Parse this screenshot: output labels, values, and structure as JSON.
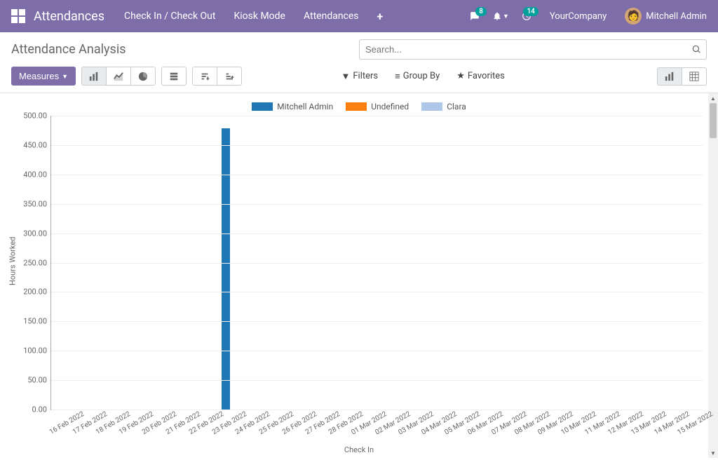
{
  "navbar": {
    "brand": "Attendances",
    "links": [
      "Check In / Check Out",
      "Kiosk Mode",
      "Attendances"
    ],
    "messages_badge": "8",
    "activities_badge": "14",
    "company": "YourCompany",
    "username": "Mitchell Admin"
  },
  "page": {
    "title": "Attendance Analysis",
    "search_placeholder": "Search..."
  },
  "toolbar": {
    "measures": "Measures",
    "filters": "Filters",
    "groupby": "Group By",
    "favorites": "Favorites"
  },
  "chart_data": {
    "type": "bar",
    "title": "",
    "ylabel": "Hours Worked",
    "xlabel": "Check In",
    "ylim": [
      0,
      500
    ],
    "y_ticks": [
      "0.00",
      "50.00",
      "100.00",
      "150.00",
      "200.00",
      "250.00",
      "300.00",
      "350.00",
      "400.00",
      "450.00",
      "500.00"
    ],
    "categories": [
      "16 Feb 2022",
      "17 Feb 2022",
      "18 Feb 2022",
      "19 Feb 2022",
      "20 Feb 2022",
      "21 Feb 2022",
      "22 Feb 2022",
      "23 Feb 2022",
      "24 Feb 2022",
      "25 Feb 2022",
      "26 Feb 2022",
      "27 Feb 2022",
      "28 Feb 2022",
      "01 Mar 2022",
      "02 Mar 2022",
      "03 Mar 2022",
      "04 Mar 2022",
      "05 Mar 2022",
      "06 Mar 2022",
      "07 Mar 2022",
      "08 Mar 2022",
      "09 Mar 2022",
      "10 Mar 2022",
      "11 Mar 2022",
      "12 Mar 2022",
      "13 Mar 2022",
      "14 Mar 2022",
      "15 Mar 2022"
    ],
    "series": [
      {
        "name": "Mitchell Admin",
        "color": "#1f77b4",
        "values": [
          0,
          0,
          0,
          0,
          0,
          0,
          0,
          478,
          0,
          0,
          0,
          0,
          0,
          0,
          0,
          0,
          0,
          0,
          0,
          0,
          0,
          0,
          0,
          0,
          0,
          0,
          0,
          0
        ]
      },
      {
        "name": "Undefined",
        "color": "#ff7f0e",
        "values": [
          0,
          0,
          0,
          0,
          0,
          0,
          0,
          0,
          0,
          0,
          0,
          0,
          0,
          0,
          0,
          0,
          0,
          0,
          0,
          0,
          0,
          0,
          0,
          0,
          0,
          0,
          0,
          0
        ]
      },
      {
        "name": "Clara",
        "color": "#aec7e8",
        "values": [
          0,
          0,
          0,
          0,
          0,
          0,
          0,
          0,
          0,
          0,
          0,
          0,
          0,
          0,
          0,
          0,
          0,
          0,
          0,
          0,
          0,
          0,
          0,
          0,
          0,
          0,
          0,
          0
        ]
      }
    ]
  }
}
